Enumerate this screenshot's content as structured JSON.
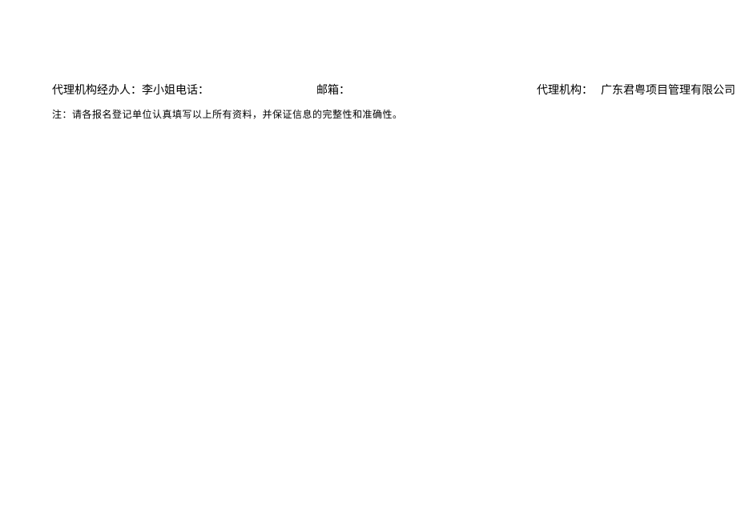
{
  "line1": {
    "handler_label": "代理机构经办人：",
    "handler_name": "李小姐",
    "phone_label": "电话：",
    "phone_value": "",
    "email_label": "邮箱：",
    "email_value": "",
    "agency_label": "代理机构：",
    "agency_name": "广东君粤项目管理有限公司"
  },
  "line2": {
    "note_label": "注：",
    "note_text": "请各报名登记单位认真填写以上所有资料，并保证信息的完整性和准确性。"
  }
}
